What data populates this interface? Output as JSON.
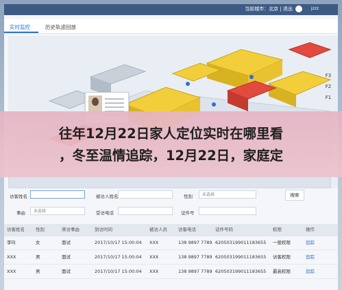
{
  "topbar": {
    "info": "当前城市：北京 | 退出",
    "user": "jzzz"
  },
  "tabs": [
    "实时监控",
    "历史轨迹回放"
  ],
  "map": {
    "zoom": [
      "F3",
      "F2",
      "F1"
    ]
  },
  "headline": {
    "line1": "往年12月22日家人定位实时在哪里看",
    "line2": "，冬至温情追踪，12月22日，家庭定"
  },
  "form": {
    "visitor_name_label": "访客姓名",
    "visited_name_label": "被访人姓名",
    "gender_label": "性别",
    "gender_value": "未选择",
    "search_button": "搜索",
    "reason_label": "事由",
    "reason_value": "未选择",
    "visit_phone_label": "受访电话",
    "id_label": "证件号"
  },
  "table": {
    "headers": [
      "访客姓名",
      "性别",
      "来访事由",
      "到访时间",
      "被访人员",
      "访客电话",
      "证件号码",
      "权限",
      "操作"
    ],
    "rows": [
      [
        "李玲",
        "女",
        "面试",
        "2017/10/17 15:00:04",
        "XXX",
        "138 9897 7789",
        "620503199011183655",
        "一般权限",
        "追踪"
      ],
      [
        "XXX",
        "男",
        "面试",
        "2017/10/17 15:00:04",
        "XXX",
        "138 9897 7789",
        "620503199011183655",
        "访客权限",
        "追踪"
      ],
      [
        "XXX",
        "男",
        "面试",
        "2017/10/17 15:00:04",
        "XXX",
        "138 9897 7789",
        "620503199011183655",
        "最高权限",
        "追踪"
      ]
    ]
  },
  "colors": {
    "accent": "#2a6fd6",
    "topbar": "#3d5a84",
    "banner": "#e6b4c3",
    "building_yellow": "#f2cf3a",
    "building_red": "#e24a3e"
  }
}
